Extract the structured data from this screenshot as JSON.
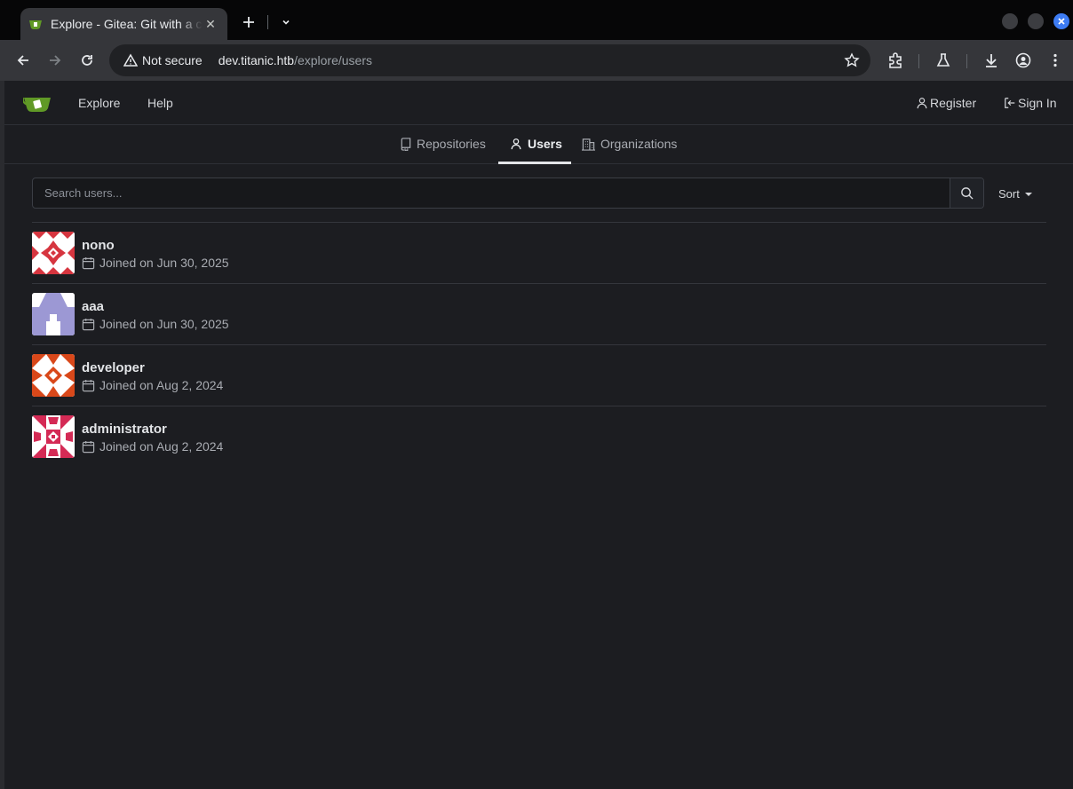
{
  "browser": {
    "tab_title": "Explore - Gitea: Git with a cup of tea",
    "security_label": "Not secure",
    "url_host": "dev.titanic.htb",
    "url_path": "/explore/users",
    "accent_color": "#3d7cf4"
  },
  "navbar": {
    "explore": "Explore",
    "help": "Help",
    "register": "Register",
    "sign_in": "Sign In"
  },
  "subnav": {
    "repositories": "Repositories",
    "users": "Users",
    "organizations": "Organizations",
    "active": "users"
  },
  "search": {
    "placeholder": "Search users...",
    "sort_label": "Sort"
  },
  "users": [
    {
      "name": "nono",
      "joined": "Joined on Jun 30, 2025",
      "avatar_color": "#d6353f"
    },
    {
      "name": "aaa",
      "joined": "Joined on Jun 30, 2025",
      "avatar_color": "#9c98d4"
    },
    {
      "name": "developer",
      "joined": "Joined on Aug 2, 2024",
      "avatar_color": "#d9481a"
    },
    {
      "name": "administrator",
      "joined": "Joined on Aug 2, 2024",
      "avatar_color": "#d42a55"
    }
  ]
}
